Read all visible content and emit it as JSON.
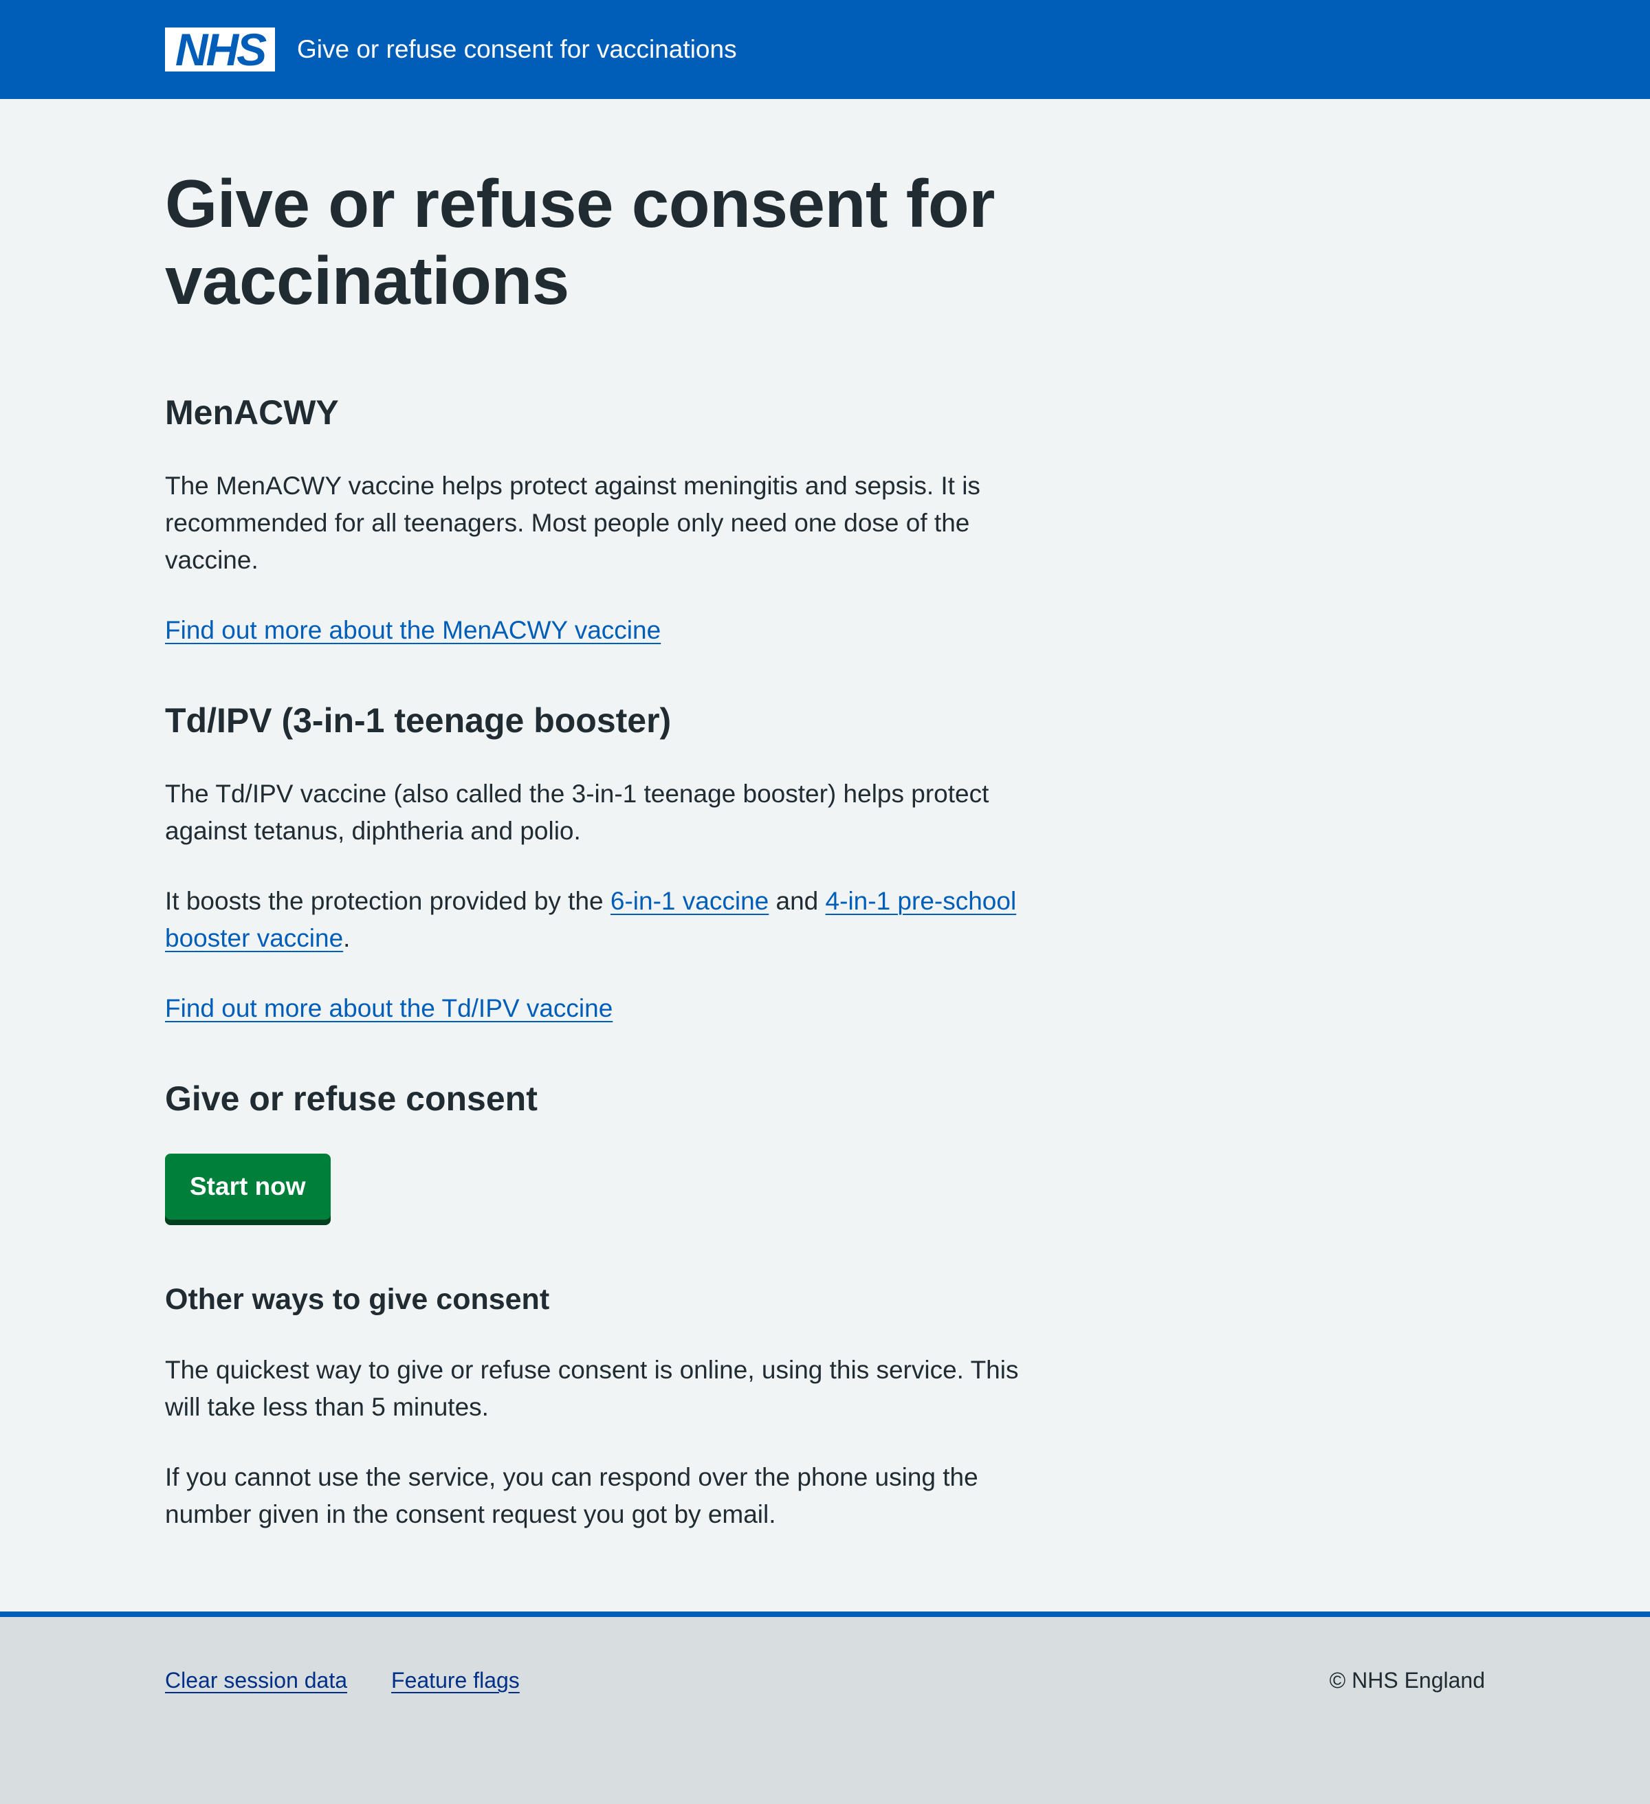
{
  "header": {
    "logo_text": "NHS",
    "service_name": "Give or refuse consent for vaccinations"
  },
  "main": {
    "title": "Give or refuse consent for vaccinations",
    "menacwy": {
      "heading": "MenACWY",
      "description": "The MenACWY vaccine helps protect against meningitis and sepsis. It is recommended for all teenagers. Most people only need one dose of the vaccine.",
      "link": "Find out more about the MenACWY vaccine"
    },
    "tdipv": {
      "heading": "Td/IPV (3-in-1 teenage booster)",
      "description": "The Td/IPV vaccine (also called the 3-in-1 teenage booster) helps protect against tetanus, diphtheria and polio.",
      "boost_prefix": "It boosts the protection provided by the ",
      "boost_link1": "6-in-1 vaccine",
      "boost_and": " and ",
      "boost_link2": "4-in-1 pre-school booster vaccine",
      "boost_suffix": ".",
      "link": "Find out more about the Td/IPV vaccine"
    },
    "consent": {
      "heading": "Give or refuse consent",
      "start_button": "Start now"
    },
    "other_ways": {
      "heading": "Other ways to give consent",
      "paragraph1": "The quickest way to give or refuse consent is online, using this service. This will take less than 5 minutes.",
      "paragraph2": "If you cannot use the service, you can respond over the phone using the number given in the consent request you got by email."
    }
  },
  "footer": {
    "links": [
      "Clear session data",
      "Feature flags"
    ],
    "copyright": "© NHS England"
  },
  "colors": {
    "nhs_blue": "#005eb8",
    "page_background": "#f0f4f5",
    "text": "#212b32",
    "button_green": "#007f3b",
    "footer_background": "#d8dde0",
    "footer_link": "#003087"
  }
}
